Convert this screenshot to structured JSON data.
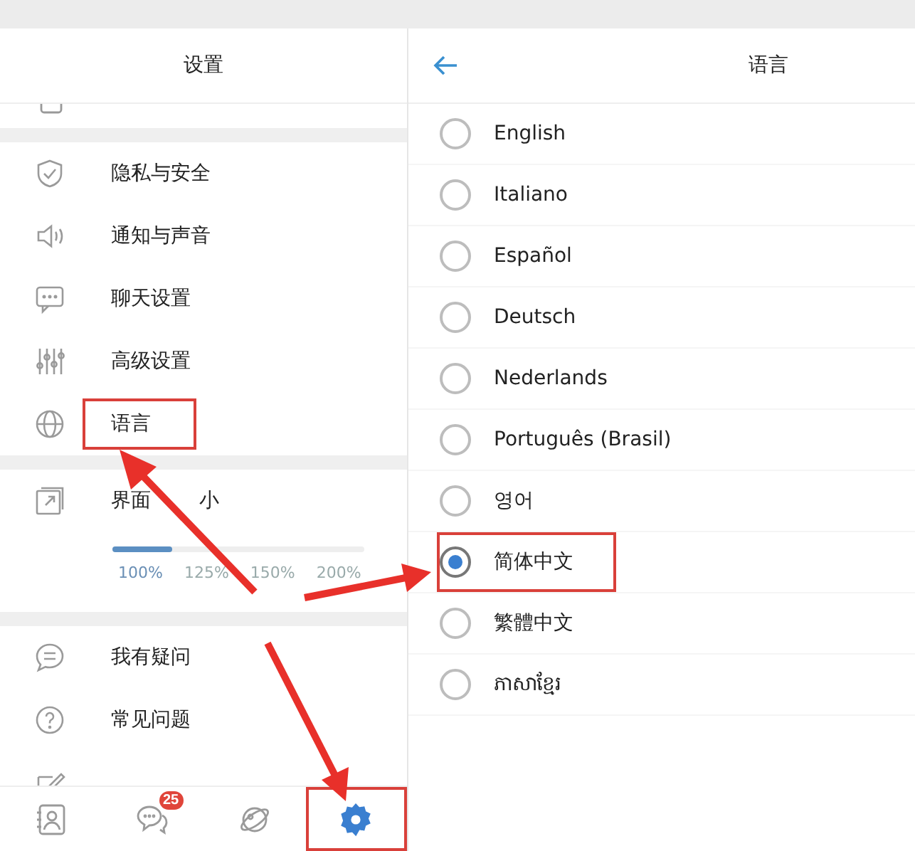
{
  "settings_panel": {
    "title": "设置",
    "items": [
      {
        "label": "隐私与安全",
        "highlighted": false
      },
      {
        "label": "通知与声音",
        "highlighted": false
      },
      {
        "label": "聊天设置",
        "highlighted": false
      },
      {
        "label": "高级设置",
        "highlighted": false
      },
      {
        "label": "语言",
        "highlighted": true
      }
    ],
    "interface_size": {
      "label": "界面",
      "label_after_arrow": "小",
      "level": 0.24,
      "options": [
        {
          "label": "100%",
          "selected": true
        },
        {
          "label": "125%",
          "selected": false
        },
        {
          "label": "150%",
          "selected": false
        },
        {
          "label": "200%",
          "selected": false
        }
      ]
    },
    "help_items": [
      {
        "label": "我有疑问"
      },
      {
        "label": "常见问题"
      }
    ]
  },
  "bottom_nav": [
    {
      "selected": false,
      "highlighted": false
    },
    {
      "selected": false,
      "highlighted": false,
      "badge": "25"
    },
    {
      "selected": false,
      "highlighted": false
    },
    {
      "selected": true,
      "highlighted": true
    }
  ],
  "language_panel": {
    "title": "语言",
    "options": [
      {
        "label": "English",
        "selected": false,
        "highlighted": false
      },
      {
        "label": "Italiano",
        "selected": false,
        "highlighted": false
      },
      {
        "label": "Español",
        "selected": false,
        "highlighted": false
      },
      {
        "label": "Deutsch",
        "selected": false,
        "highlighted": false
      },
      {
        "label": "Nederlands",
        "selected": false,
        "highlighted": false
      },
      {
        "label": "Português (Brasil)",
        "selected": false,
        "highlighted": false
      },
      {
        "label": "영어",
        "selected": false,
        "highlighted": false
      },
      {
        "label": "简体中文",
        "selected": true,
        "highlighted": true
      },
      {
        "label": "繁體中文",
        "selected": false,
        "highlighted": false
      },
      {
        "label": "ភាសាខ្មែរ",
        "selected": false,
        "highlighted": false
      }
    ]
  }
}
